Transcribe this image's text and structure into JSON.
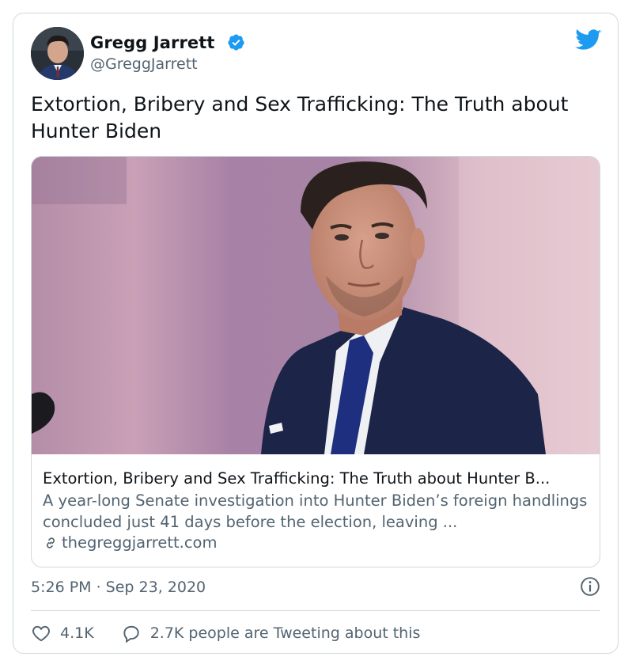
{
  "user": {
    "display_name": "Gregg Jarrett",
    "handle": "@GreggJarrett",
    "verified_icon": "verified-badge-icon",
    "avatar": "avatar-photo"
  },
  "brand_icon": "twitter-bird-icon",
  "tweet": {
    "text": "Extortion, Bribery and Sex Trafficking: The Truth about Hunter Biden"
  },
  "card": {
    "image": "card-photo",
    "title": "Extortion, Bribery and Sex Trafficking: The Truth about Hunter B...",
    "description": "A year-long Senate investigation into Hunter Biden’s foreign handlings concluded just 41 days before the election, leaving ...",
    "domain": "thegreggjarrett.com",
    "link_icon": "link-icon"
  },
  "meta": {
    "timestamp": "5:26 PM · Sep 23, 2020",
    "info_icon": "info-icon"
  },
  "actions": {
    "likes": "4.1K",
    "reply_text": "2.7K people are Tweeting about this"
  },
  "colors": {
    "accent": "#1d9bf0",
    "text": "#0f1419",
    "secondary": "#536471",
    "border": "#cfd9de"
  }
}
